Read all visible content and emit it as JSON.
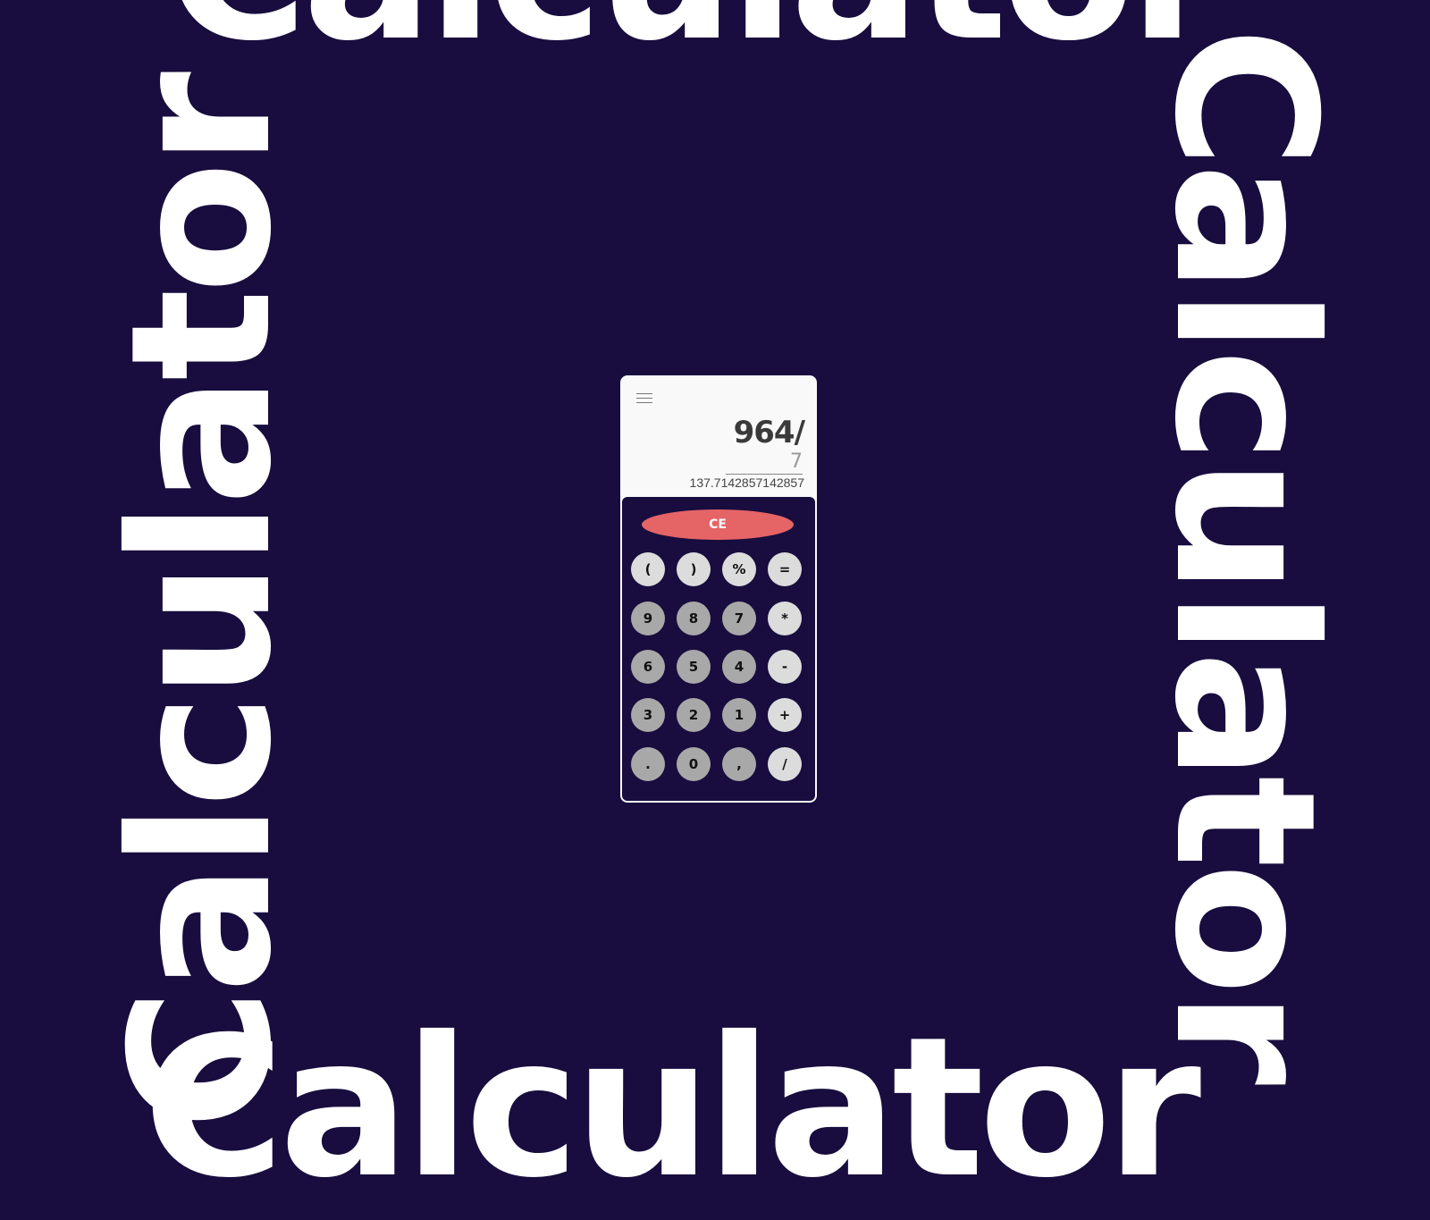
{
  "background": {
    "color": "#180d3e",
    "word": "Calculator"
  },
  "display": {
    "expression": "964/",
    "input": "7",
    "result": "137.7142857142857"
  },
  "menu": {
    "icon": "hamburger-menu-icon"
  },
  "keypad": {
    "clear_label": "CE",
    "clear_color": "#e56466",
    "rows": [
      [
        {
          "label": "(",
          "tone": "light"
        },
        {
          "label": ")",
          "tone": "light"
        },
        {
          "label": "%",
          "tone": "light"
        },
        {
          "label": "=",
          "tone": "light"
        }
      ],
      [
        {
          "label": "9",
          "tone": "dark"
        },
        {
          "label": "8",
          "tone": "dark"
        },
        {
          "label": "7",
          "tone": "dark"
        },
        {
          "label": "*",
          "tone": "light"
        }
      ],
      [
        {
          "label": "6",
          "tone": "dark"
        },
        {
          "label": "5",
          "tone": "dark"
        },
        {
          "label": "4",
          "tone": "dark"
        },
        {
          "label": "-",
          "tone": "light"
        }
      ],
      [
        {
          "label": "3",
          "tone": "dark"
        },
        {
          "label": "2",
          "tone": "dark"
        },
        {
          "label": "1",
          "tone": "dark"
        },
        {
          "label": "+",
          "tone": "light"
        }
      ],
      [
        {
          "label": ".",
          "tone": "dark"
        },
        {
          "label": "0",
          "tone": "dark"
        },
        {
          "label": ",",
          "tone": "dark"
        },
        {
          "label": "/",
          "tone": "light"
        }
      ]
    ]
  }
}
